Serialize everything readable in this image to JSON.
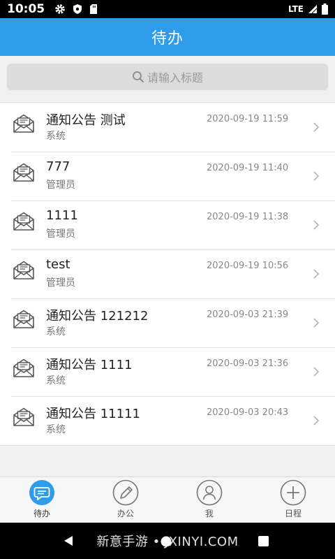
{
  "status_bar": {
    "time": "10:05",
    "network": "LTE",
    "icons_left": [
      "gear-icon",
      "shield-icon",
      "sd-card-icon"
    ],
    "icons_right": [
      "signal-icon",
      "battery-icon"
    ]
  },
  "header": {
    "title": "待办",
    "color": "#2e9ce8"
  },
  "search": {
    "placeholder": "请输入标题"
  },
  "items": [
    {
      "title": "通知公告 测试",
      "sender": "系统",
      "time": "2020-09-19 11:59"
    },
    {
      "title": "777",
      "sender": "管理员",
      "time": "2020-09-19 11:40"
    },
    {
      "title": "1111",
      "sender": "管理员",
      "time": "2020-09-19 11:38"
    },
    {
      "title": "test",
      "sender": "管理员",
      "time": "2020-09-19 10:56"
    },
    {
      "title": "通知公告 121212",
      "sender": "系统",
      "time": "2020-09-03 21:39"
    },
    {
      "title": "通知公告 1111",
      "sender": "系统",
      "time": "2020-09-03 21:36"
    },
    {
      "title": "通知公告 11111",
      "sender": "系统",
      "time": "2020-09-03 20:43"
    }
  ],
  "tabs": [
    {
      "label": "待办",
      "icon": "chat-bubble-icon",
      "active": true
    },
    {
      "label": "办公",
      "icon": "pencil-icon",
      "active": false
    },
    {
      "label": "我",
      "icon": "user-icon",
      "active": false
    },
    {
      "label": "日程",
      "icon": "plus-circle-icon",
      "active": false
    }
  ],
  "nav_bar": {
    "watermark": "新意手游 • JXINYI.COM"
  }
}
